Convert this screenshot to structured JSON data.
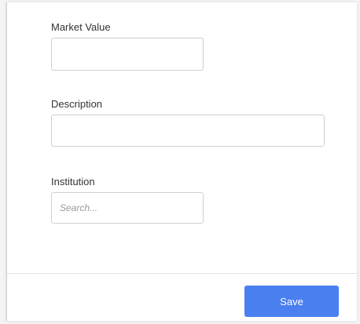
{
  "form": {
    "market_value": {
      "label": "Market Value",
      "value": "",
      "placeholder": ""
    },
    "description": {
      "label": "Description",
      "value": "",
      "placeholder": ""
    },
    "institution": {
      "label": "Institution",
      "value": "",
      "placeholder": "Search..."
    }
  },
  "footer": {
    "save_label": "Save"
  },
  "colors": {
    "accent": "#4a7ff0",
    "border": "#cfcfcf",
    "label": "#333333"
  }
}
